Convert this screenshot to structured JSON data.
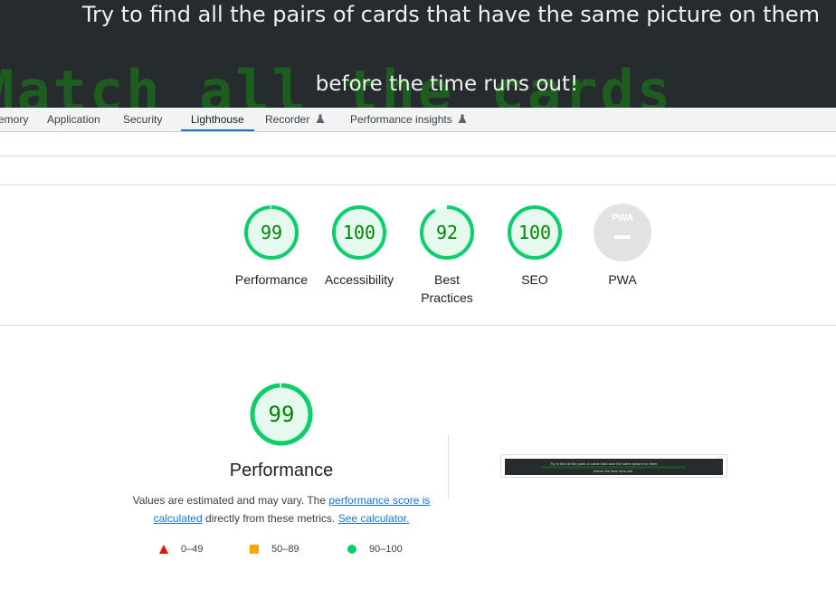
{
  "banner": {
    "line1": "Try to find all the pairs of cards that have the same picture on them",
    "line2": "before the time runs out!",
    "background_text": "Match all the cards"
  },
  "devtools_tabs": [
    {
      "label": "Memory",
      "active": false
    },
    {
      "label": "Application",
      "active": false
    },
    {
      "label": "Security",
      "active": false
    },
    {
      "label": "Lighthouse",
      "active": true
    },
    {
      "label": "Recorder",
      "active": false,
      "icon": "flask-icon"
    },
    {
      "label": "Performance insights",
      "active": false,
      "icon": "flask-icon"
    }
  ],
  "scores": [
    {
      "label": "Performance",
      "value": "99",
      "fraction": 0.99
    },
    {
      "label": "Accessibility",
      "value": "100",
      "fraction": 1.0
    },
    {
      "label": "Best Practices",
      "value": "92",
      "fraction": 0.92
    },
    {
      "label": "SEO",
      "value": "100",
      "fraction": 1.0
    }
  ],
  "pwa": {
    "label": "PWA",
    "badge_text": "PWA"
  },
  "performance_section": {
    "score": "99",
    "fraction": 0.99,
    "title": "Performance",
    "desc_pre": "Values are estimated and may vary. The ",
    "desc_link1": "performance score is calculated",
    "desc_mid": " directly from these metrics. ",
    "desc_link2": "See calculator."
  },
  "legend": [
    {
      "range": "0–49",
      "shape": "triangle",
      "color": "#eb0f00"
    },
    {
      "range": "50–89",
      "shape": "square",
      "color": "#ffa400"
    },
    {
      "range": "90–100",
      "shape": "circle",
      "color": "#0cce6b"
    }
  ],
  "thumbnail": {
    "line1": "Try to find all the pairs of cards that have the same picture on them",
    "line2": "before the time runs out!"
  },
  "colors": {
    "pass": "#0cce6b",
    "pass_fill": "#e6f9ee",
    "pass_text": "#018400",
    "accent": "#1a73e8"
  }
}
